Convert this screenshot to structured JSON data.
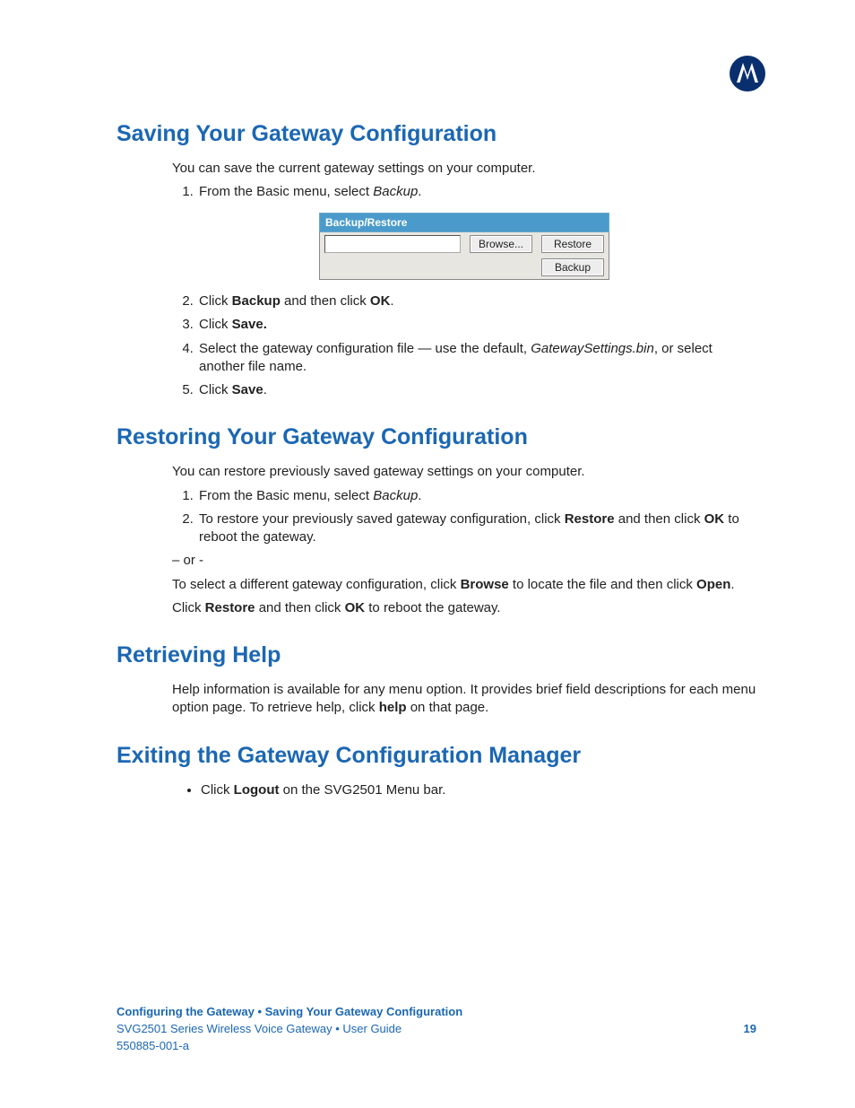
{
  "logo_name": "motorola-logo-icon",
  "sections": {
    "saving": {
      "heading": "Saving Your Gateway Configuration",
      "intro": "You can save the current gateway settings on your computer.",
      "step1_a": "From the Basic menu, select ",
      "step1_em": "Backup",
      "step1_b": ".",
      "widget": {
        "title": "Backup/Restore",
        "browse": "Browse...",
        "restore": "Restore",
        "backup": "Backup"
      },
      "step2_a": "Click ",
      "step2_b1": "Backup",
      "step2_c": " and then click ",
      "step2_b2": "OK",
      "step2_d": ".",
      "step3_a": "Click ",
      "step3_b": "Save.",
      "step4_a": "Select the gateway configuration file — use the default, ",
      "step4_em": "GatewaySettings.bin",
      "step4_b": ", or select another file name.",
      "step5_a": "Click ",
      "step5_b": "Save",
      "step5_c": "."
    },
    "restoring": {
      "heading": "Restoring Your Gateway Configuration",
      "intro": "You can restore previously saved gateway settings on your computer.",
      "step1_a": "From the Basic menu, select ",
      "step1_em": "Backup",
      "step1_b": ".",
      "step2_a": "To restore your previously saved gateway configuration, click ",
      "step2_b1": "Restore",
      "step2_c": " and then click ",
      "step2_b2": "OK",
      "step2_d": " to reboot the gateway.",
      "or": "– or -",
      "alt1_a": "To select a different gateway configuration, click ",
      "alt1_b1": "Browse",
      "alt1_c": " to locate the file and then click ",
      "alt1_b2": "Open",
      "alt1_d": ".",
      "alt2_a": "Click ",
      "alt2_b1": "Restore",
      "alt2_c": " and then click ",
      "alt2_b2": "OK",
      "alt2_d": " to reboot the gateway."
    },
    "help": {
      "heading": "Retrieving Help",
      "p_a": "Help information is available for any menu option. It provides brief field descriptions for each menu option page. To retrieve help, click ",
      "p_b": "help",
      "p_c": " on that page."
    },
    "exiting": {
      "heading": "Exiting the Gateway Configuration Manager",
      "li_a": "Click ",
      "li_b": "Logout",
      "li_c": " on the SVG2501 Menu bar."
    }
  },
  "footer": {
    "breadcrumb": "Configuring the Gateway • Saving Your Gateway Configuration",
    "guide": "SVG2501 Series Wireless Voice Gateway • User Guide",
    "page": "19",
    "docnum": "550885-001-a"
  }
}
